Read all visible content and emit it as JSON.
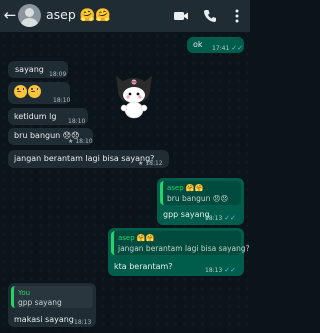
{
  "header": {
    "back_icon": "back-arrow-icon",
    "contact_name": "asep 🤗🤗",
    "icons": [
      "video-call-icon",
      "voice-call-icon",
      "more-options-icon"
    ]
  },
  "messages": [
    {
      "id": "m1",
      "dir": "out",
      "text": "ok",
      "time": "17:41",
      "read": true
    },
    {
      "id": "m2",
      "dir": "in",
      "text": "sayang",
      "time": "18:09"
    },
    {
      "id": "m3",
      "dir": "in",
      "text": "😞😞",
      "time": "18:10"
    },
    {
      "id": "m4",
      "dir": "in",
      "text": "ketidum lg",
      "time": "18:10"
    },
    {
      "id": "m5",
      "dir": "in",
      "text": "bru bangun 😞😞",
      "time": "18:10",
      "starred": true
    },
    {
      "id": "m6",
      "dir": "in",
      "text": "jangan berantam lagi bisa sayang?",
      "time": "18:12",
      "starred": true
    },
    {
      "id": "m7",
      "dir": "out",
      "quote_name": "asep 🤗🤗",
      "quote_text": "bru bangun 😞😞",
      "text": "gpp sayang",
      "time": "18:13",
      "read": true
    },
    {
      "id": "m8",
      "dir": "out",
      "quote_name": "asep 🤗🤗",
      "quote_text": "jangan berantam lagi bisa sayang?",
      "text": "kta berantam?",
      "time": "18:13",
      "read": true
    },
    {
      "id": "m9",
      "dir": "in",
      "quote_name": "You",
      "quote_text": "gpp sayang",
      "text": "makasi sayang",
      "time": "18:13"
    }
  ],
  "colors": {
    "incoming": "#1f2c34",
    "outgoing": "#005c4b",
    "accent": "#25d366",
    "read_ticks": "#53bdeb"
  }
}
